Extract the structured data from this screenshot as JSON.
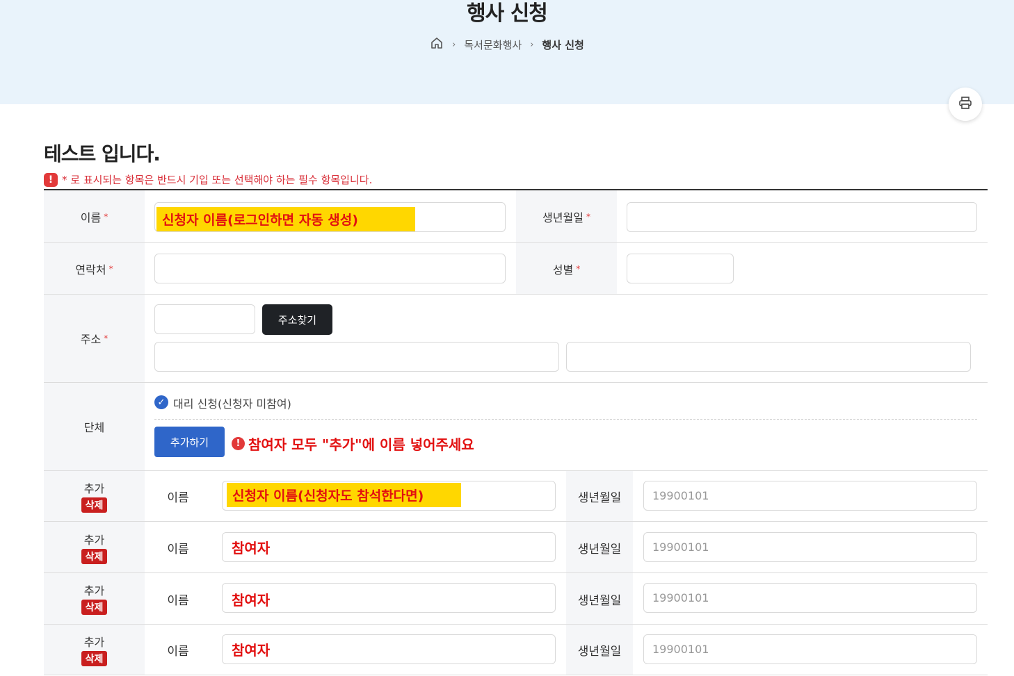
{
  "header": {
    "title": "행사 신청",
    "breadcrumb": {
      "home_icon": "home-icon",
      "level1": "독서문화행사",
      "current": "행사 신청"
    },
    "print_icon": "printer-icon"
  },
  "page": {
    "title": "테스트 입니다.",
    "required_notice": "* 로 표시되는 항목은 반드시 기입 또는 선택해야 하는 필수 항목입니다.",
    "required_mark": "*"
  },
  "form": {
    "name_label": "이름",
    "name_value": "신청자 이름(로그인하면 자동 생성)",
    "birth_label": "생년월일",
    "phone_label": "연락처",
    "gender_label": "성별",
    "address_label": "주소",
    "address_search_button": "주소찾기",
    "group_label": "단체",
    "proxy_checkbox_label": "대리 신청(신청자 미참여)",
    "add_button": "추가하기",
    "add_warning": "참여자 모두 \"추가\"에 이름 넣어주세요"
  },
  "participants": {
    "add_label": "추가",
    "delete_label": "삭제",
    "name_label": "이름",
    "birth_label": "생년월일",
    "rows": [
      {
        "name": "신청자 이름(신청자도 참석한다면)",
        "birth_placeholder": "19900101"
      },
      {
        "name": "참여자",
        "birth_placeholder": "19900101"
      },
      {
        "name": "참여자",
        "birth_placeholder": "19900101"
      },
      {
        "name": "참여자",
        "birth_placeholder": "19900101"
      }
    ]
  },
  "colors": {
    "accent_blue": "#2f66c9",
    "required_red": "#e23a3a",
    "highlight_yellow": "#ffd700",
    "dark_button": "#1f2226"
  }
}
